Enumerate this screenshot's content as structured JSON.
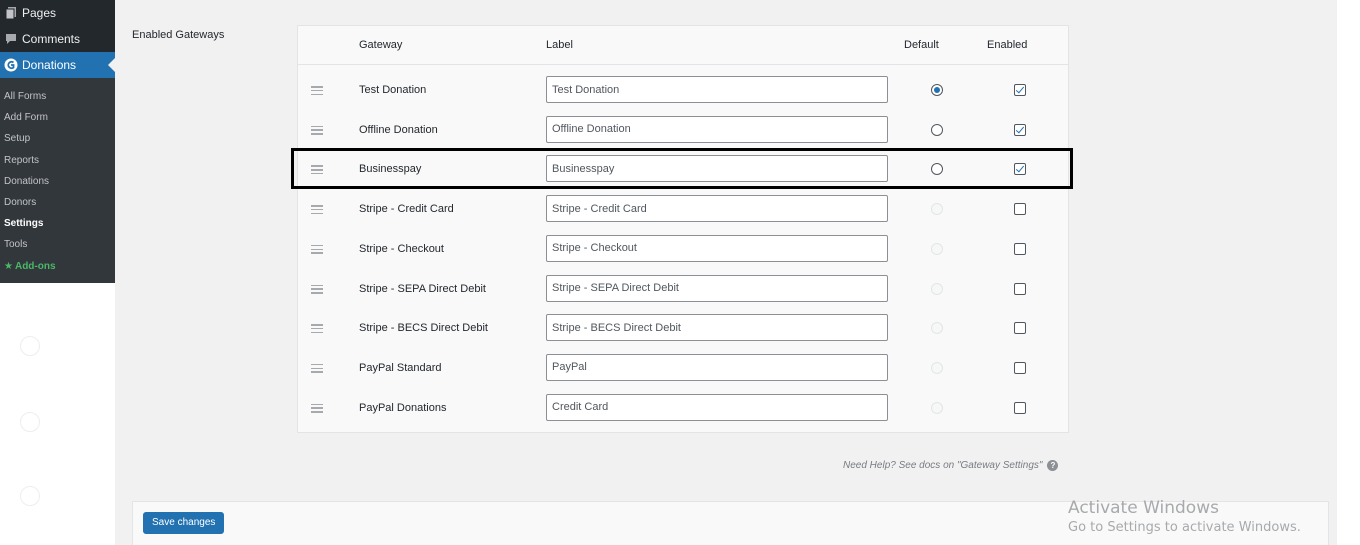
{
  "sidebar": {
    "top_items": [
      {
        "label": "Pages",
        "icon": "pages-icon"
      },
      {
        "label": "Comments",
        "icon": "comments-icon"
      },
      {
        "label": "Donations",
        "icon": "donations-icon"
      }
    ],
    "submenu": [
      {
        "label": "All Forms"
      },
      {
        "label": "Add Form"
      },
      {
        "label": "Setup"
      },
      {
        "label": "Reports"
      },
      {
        "label": "Donations"
      },
      {
        "label": "Donors"
      },
      {
        "label": "Settings"
      },
      {
        "label": "Tools"
      },
      {
        "label": "Add-ons"
      }
    ]
  },
  "section_label": "Enabled Gateways",
  "table": {
    "headers": {
      "gateway": "Gateway",
      "label": "Label",
      "default": "Default",
      "enabled": "Enabled"
    },
    "rows": [
      {
        "gateway": "Test Donation",
        "label": "Test Donation",
        "default": "selected",
        "enabled": true
      },
      {
        "gateway": "Offline Donation",
        "label": "Offline Donation",
        "default": "unselected",
        "enabled": true
      },
      {
        "gateway": "Businesspay",
        "label": "Businesspay",
        "default": "unselected",
        "enabled": true
      },
      {
        "gateway": "Stripe - Credit Card",
        "label": "Stripe - Credit Card",
        "default": "disabled",
        "enabled": false
      },
      {
        "gateway": "Stripe - Checkout",
        "label": "Stripe - Checkout",
        "default": "disabled",
        "enabled": false
      },
      {
        "gateway": "Stripe - SEPA Direct Debit",
        "label": "Stripe - SEPA Direct Debit",
        "default": "disabled",
        "enabled": false
      },
      {
        "gateway": "Stripe - BECS Direct Debit",
        "label": "Stripe - BECS Direct Debit",
        "default": "disabled",
        "enabled": false
      },
      {
        "gateway": "PayPal Standard",
        "label": "PayPal",
        "default": "disabled",
        "enabled": false
      },
      {
        "gateway": "PayPal Donations",
        "label": "Credit Card",
        "default": "disabled",
        "enabled": false
      }
    ]
  },
  "help": {
    "text": "Need Help? See docs on \"Gateway Settings\"",
    "icon": "?"
  },
  "save_button": "Save changes",
  "watermark": {
    "title": "Activate Windows",
    "subtitle": "Go to Settings to activate Windows."
  },
  "colors": {
    "accent": "#2271b1",
    "sidebar_bg": "#23282d",
    "addons_green": "#4ab866",
    "highlight_border": "#000000"
  }
}
